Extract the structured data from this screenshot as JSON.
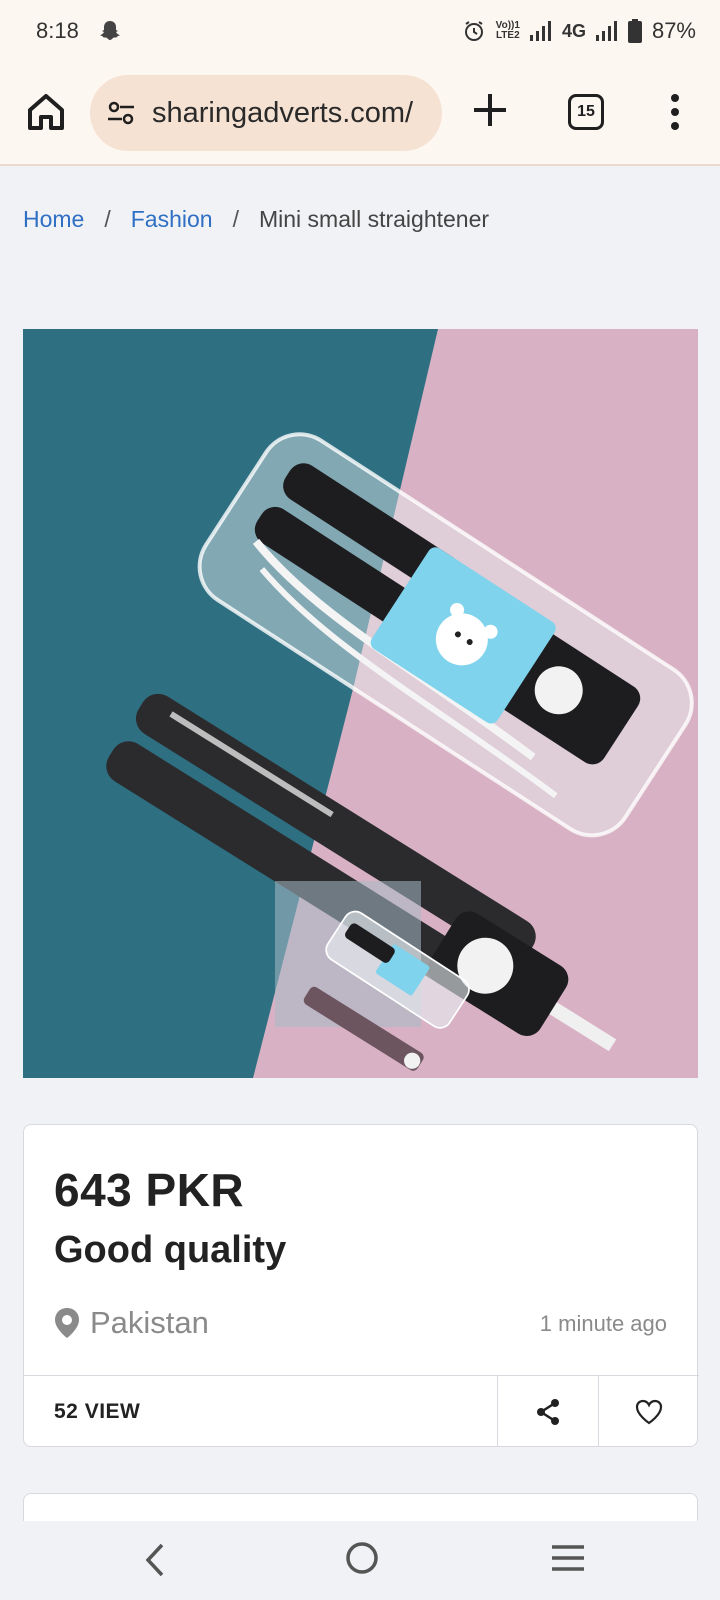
{
  "status_bar": {
    "time": "8:18",
    "volte_top": "Vo))1",
    "volte_bottom": "LTE2",
    "network": "4G",
    "battery": "87%",
    "icons": [
      "snapchat-ghost-icon",
      "alarm-icon",
      "signal-icon",
      "signal-icon",
      "battery-icon"
    ]
  },
  "browser": {
    "url": "sharingadverts.com/",
    "tab_count": "15",
    "icons": [
      "home-icon",
      "site-settings-icon",
      "plus-icon",
      "more-vert-icon"
    ]
  },
  "breadcrumb": {
    "home": "Home",
    "separator": "/",
    "category": "Fashion",
    "current": "Mini small straightener"
  },
  "listing": {
    "price": "643 PKR",
    "title": "Good quality",
    "location": "Pakistan",
    "posted": "1 minute ago",
    "views": "52 VIEW",
    "icons": [
      "location-pin-icon",
      "share-icon",
      "heart-icon"
    ]
  },
  "nav_bar": {
    "icons": [
      "back-icon",
      "home-circle-icon",
      "recent-apps-icon"
    ]
  },
  "colors": {
    "link": "#2f6fc4",
    "chrome_bg": "#fdf7f2",
    "url_pill": "#f6e2d3",
    "page_bg": "#f1f2f6",
    "image_teal": "#2f6f82",
    "image_pink": "#d8b2c4"
  }
}
